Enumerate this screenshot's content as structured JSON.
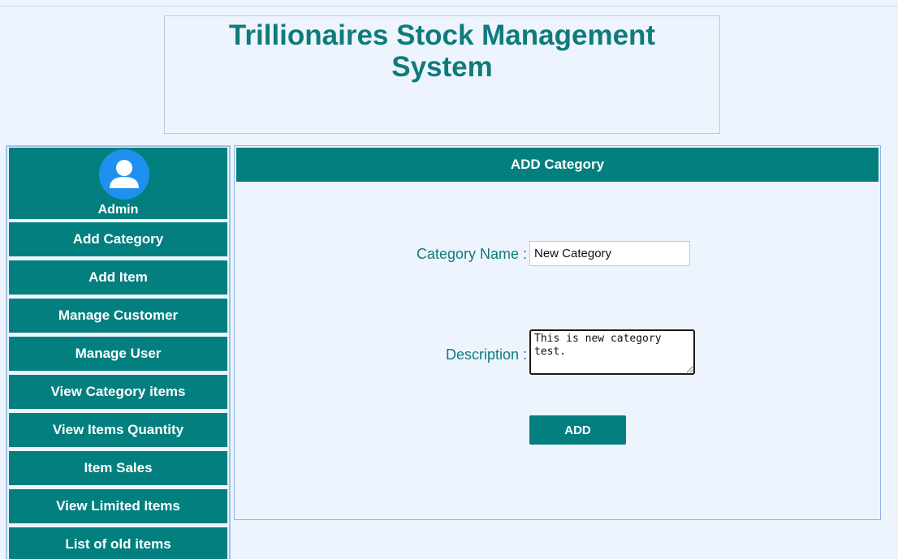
{
  "header": {
    "title": "Trillionaires Stock Management System"
  },
  "sidebar": {
    "profile": {
      "name": "Admin",
      "avatar_icon": "user-avatar-icon"
    },
    "items": [
      {
        "label": "Add Category"
      },
      {
        "label": "Add Item"
      },
      {
        "label": "Manage Customer"
      },
      {
        "label": "Manage User"
      },
      {
        "label": "View Category items"
      },
      {
        "label": "View Items Quantity"
      },
      {
        "label": "Item Sales"
      },
      {
        "label": "View Limited Items"
      },
      {
        "label": "List of old items"
      }
    ]
  },
  "main": {
    "panel_title": "ADD Category",
    "form": {
      "category_name_label": "Category Name :",
      "category_name_value": "New Category",
      "description_label": "Description :",
      "description_value": "This is new category test.",
      "submit_label": "ADD"
    }
  },
  "colors": {
    "primary": "#037f7f",
    "title_text": "#0f7b7b",
    "background": "#edf4fd",
    "avatar": "#1e90ef"
  }
}
